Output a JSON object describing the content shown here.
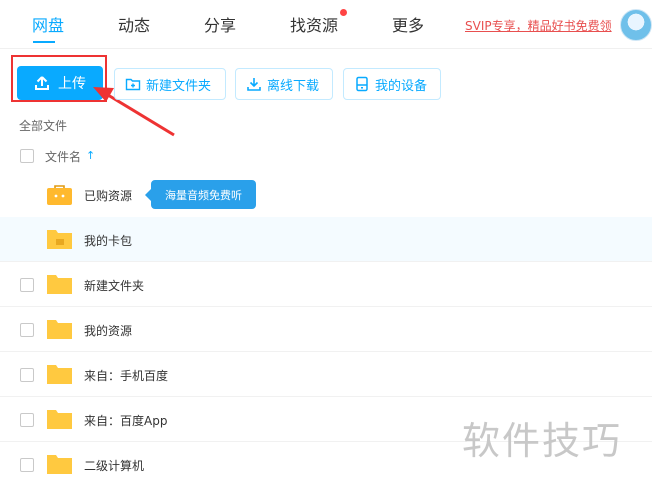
{
  "nav": {
    "tabs": [
      {
        "label": "网盘",
        "active": true
      },
      {
        "label": "动态"
      },
      {
        "label": "分享"
      },
      {
        "label": "找资源"
      },
      {
        "label": "更多"
      }
    ],
    "svip_link": "SVIP专享，精品好书免费领"
  },
  "toolbar": {
    "upload_label": "上传",
    "new_folder_label": "新建文件夹",
    "offline_download_label": "离线下载",
    "my_devices_label": "我的设备"
  },
  "breadcrumb": "全部文件",
  "list_header": {
    "name_col": "文件名"
  },
  "tooltip": "海量音频免费听",
  "files": [
    {
      "name": "已购资源",
      "icon": "purchased-folder-icon"
    },
    {
      "name": "我的卡包",
      "icon": "card-folder-icon"
    },
    {
      "name": "新建文件夹",
      "icon": "folder-icon"
    },
    {
      "name": "我的资源",
      "icon": "folder-icon"
    },
    {
      "name": "来自：手机百度",
      "icon": "folder-icon"
    },
    {
      "name": "来自：百度App",
      "icon": "folder-icon"
    },
    {
      "name": "二级计算机",
      "icon": "folder-icon"
    }
  ],
  "watermark": "软件技巧",
  "colors": {
    "accent": "#09aaff",
    "annotation": "#e33333",
    "folder": "#ffc940"
  }
}
